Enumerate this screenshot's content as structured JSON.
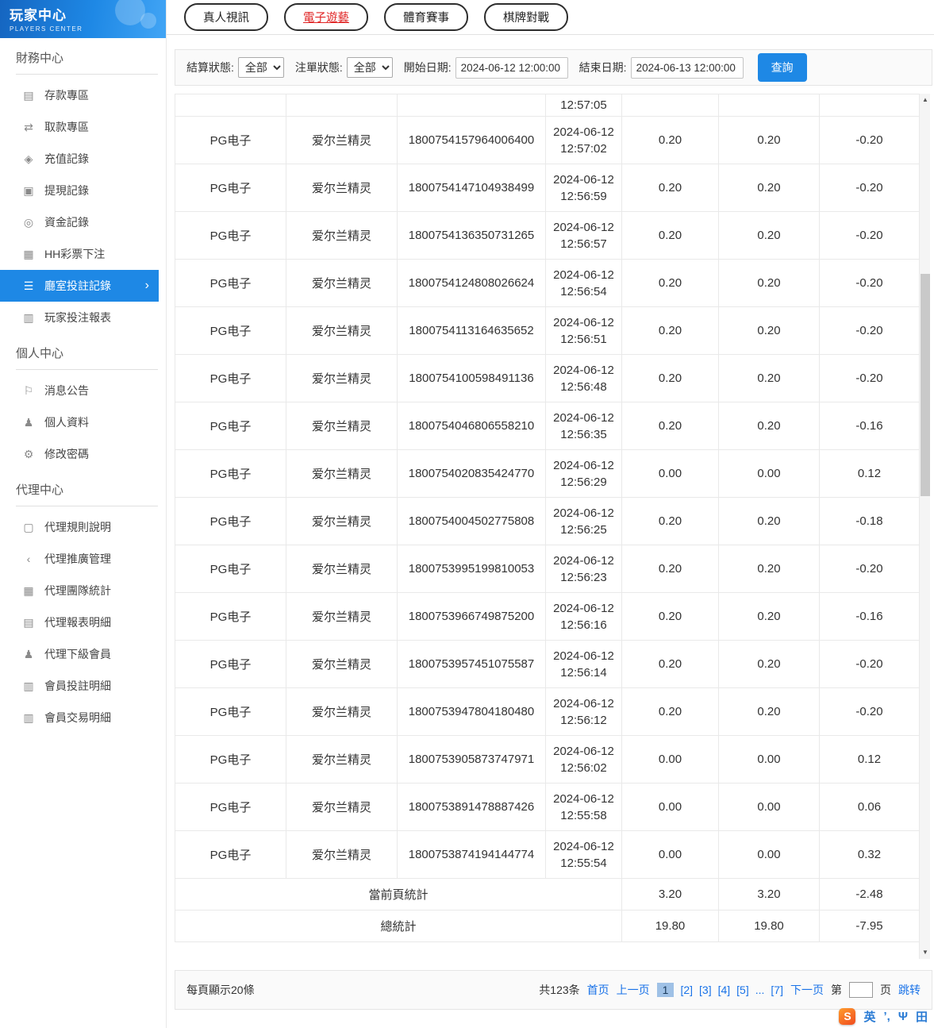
{
  "sidebar": {
    "title": "玩家中心",
    "subtitle": "PLAYERS CENTER",
    "finance": {
      "heading": "財務中心",
      "items": [
        {
          "label": "存款專區",
          "icon": "deposit-icon"
        },
        {
          "label": "取款專區",
          "icon": "withdraw-icon"
        },
        {
          "label": "充值記錄",
          "icon": "recharge-icon"
        },
        {
          "label": "提現記錄",
          "icon": "cashout-icon"
        },
        {
          "label": "資金記錄",
          "icon": "funds-icon"
        },
        {
          "label": "HH彩票下注",
          "icon": "lottery-icon"
        },
        {
          "label": "廳室投註記錄",
          "icon": "room-bet-record-icon",
          "active": true
        },
        {
          "label": "玩家投注報表",
          "icon": "player-report-icon"
        }
      ]
    },
    "personal": {
      "heading": "個人中心",
      "items": [
        {
          "label": "消息公告",
          "icon": "announcement-icon"
        },
        {
          "label": "個人資料",
          "icon": "profile-icon"
        },
        {
          "label": "修改密碼",
          "icon": "password-icon"
        }
      ]
    },
    "agent": {
      "heading": "代理中心",
      "items": [
        {
          "label": "代理規則說明",
          "icon": "agent-rules-icon"
        },
        {
          "label": "代理推廣管理",
          "icon": "agent-promo-icon"
        },
        {
          "label": "代理團隊統計",
          "icon": "agent-team-icon"
        },
        {
          "label": "代理報表明細",
          "icon": "agent-report-icon"
        },
        {
          "label": "代理下級會員",
          "icon": "agent-members-icon"
        },
        {
          "label": "會員投註明細",
          "icon": "member-bet-detail-icon"
        },
        {
          "label": "會員交易明細",
          "icon": "member-trans-detail-icon"
        }
      ]
    }
  },
  "tabs": [
    {
      "label": "真人視訊"
    },
    {
      "label": "電子遊藝",
      "active": true
    },
    {
      "label": "體育賽事"
    },
    {
      "label": "棋牌對戰"
    }
  ],
  "filters": {
    "settle_status_label": "結算狀態:",
    "settle_status_value": "全部",
    "order_status_label": "注單狀態:",
    "order_status_value": "全部",
    "start_date_label": "開始日期:",
    "start_date_value": "2024-06-12 12:00:00",
    "end_date_label": "結束日期:",
    "end_date_value": "2024-06-13 12:00:00",
    "search_label": "查詢"
  },
  "table": {
    "partial_row": {
      "time": "12:57:05"
    },
    "rows": [
      {
        "platform": "PG电子",
        "game": "爱尔兰精灵",
        "order": "1800754157964006400",
        "date": "2024-06-12",
        "time": "12:57:02",
        "bet": "0.20",
        "valid": "0.20",
        "winloss": "-0.20"
      },
      {
        "platform": "PG电子",
        "game": "爱尔兰精灵",
        "order": "1800754147104938499",
        "date": "2024-06-12",
        "time": "12:56:59",
        "bet": "0.20",
        "valid": "0.20",
        "winloss": "-0.20"
      },
      {
        "platform": "PG电子",
        "game": "爱尔兰精灵",
        "order": "1800754136350731265",
        "date": "2024-06-12",
        "time": "12:56:57",
        "bet": "0.20",
        "valid": "0.20",
        "winloss": "-0.20"
      },
      {
        "platform": "PG电子",
        "game": "爱尔兰精灵",
        "order": "1800754124808026624",
        "date": "2024-06-12",
        "time": "12:56:54",
        "bet": "0.20",
        "valid": "0.20",
        "winloss": "-0.20"
      },
      {
        "platform": "PG电子",
        "game": "爱尔兰精灵",
        "order": "1800754113164635652",
        "date": "2024-06-12",
        "time": "12:56:51",
        "bet": "0.20",
        "valid": "0.20",
        "winloss": "-0.20"
      },
      {
        "platform": "PG电子",
        "game": "爱尔兰精灵",
        "order": "1800754100598491136",
        "date": "2024-06-12",
        "time": "12:56:48",
        "bet": "0.20",
        "valid": "0.20",
        "winloss": "-0.20"
      },
      {
        "platform": "PG电子",
        "game": "爱尔兰精灵",
        "order": "1800754046806558210",
        "date": "2024-06-12",
        "time": "12:56:35",
        "bet": "0.20",
        "valid": "0.20",
        "winloss": "-0.16"
      },
      {
        "platform": "PG电子",
        "game": "爱尔兰精灵",
        "order": "1800754020835424770",
        "date": "2024-06-12",
        "time": "12:56:29",
        "bet": "0.00",
        "valid": "0.00",
        "winloss": "0.12"
      },
      {
        "platform": "PG电子",
        "game": "爱尔兰精灵",
        "order": "1800754004502775808",
        "date": "2024-06-12",
        "time": "12:56:25",
        "bet": "0.20",
        "valid": "0.20",
        "winloss": "-0.18"
      },
      {
        "platform": "PG电子",
        "game": "爱尔兰精灵",
        "order": "1800753995199810053",
        "date": "2024-06-12",
        "time": "12:56:23",
        "bet": "0.20",
        "valid": "0.20",
        "winloss": "-0.20"
      },
      {
        "platform": "PG电子",
        "game": "爱尔兰精灵",
        "order": "1800753966749875200",
        "date": "2024-06-12",
        "time": "12:56:16",
        "bet": "0.20",
        "valid": "0.20",
        "winloss": "-0.16"
      },
      {
        "platform": "PG电子",
        "game": "爱尔兰精灵",
        "order": "1800753957451075587",
        "date": "2024-06-12",
        "time": "12:56:14",
        "bet": "0.20",
        "valid": "0.20",
        "winloss": "-0.20"
      },
      {
        "platform": "PG电子",
        "game": "爱尔兰精灵",
        "order": "1800753947804180480",
        "date": "2024-06-12",
        "time": "12:56:12",
        "bet": "0.20",
        "valid": "0.20",
        "winloss": "-0.20"
      },
      {
        "platform": "PG电子",
        "game": "爱尔兰精灵",
        "order": "1800753905873747971",
        "date": "2024-06-12",
        "time": "12:56:02",
        "bet": "0.00",
        "valid": "0.00",
        "winloss": "0.12"
      },
      {
        "platform": "PG电子",
        "game": "爱尔兰精灵",
        "order": "1800753891478887426",
        "date": "2024-06-12",
        "time": "12:55:58",
        "bet": "0.00",
        "valid": "0.00",
        "winloss": "0.06"
      },
      {
        "platform": "PG电子",
        "game": "爱尔兰精灵",
        "order": "1800753874194144774",
        "date": "2024-06-12",
        "time": "12:55:54",
        "bet": "0.00",
        "valid": "0.00",
        "winloss": "0.32"
      }
    ],
    "page_summary": {
      "label": "當前頁統計",
      "bet": "3.20",
      "valid": "3.20",
      "winloss": "-2.48"
    },
    "total_summary": {
      "label": "總統計",
      "bet": "19.80",
      "valid": "19.80",
      "winloss": "-7.95"
    }
  },
  "pagination": {
    "per_page_text": "每頁顯示20條",
    "total_text": "共123条",
    "first": "首页",
    "prev": "上一页",
    "pages": [
      {
        "label": "1",
        "current": true
      },
      {
        "label": "[2]"
      },
      {
        "label": "[3]"
      },
      {
        "label": "[4]"
      },
      {
        "label": "[5]"
      },
      {
        "label": "..."
      },
      {
        "label": "[7]"
      }
    ],
    "next": "下一页",
    "jump_prefix": "第",
    "jump_suffix": "页",
    "jump_action": "跳转"
  },
  "ime": {
    "logo": "S",
    "lang": "英",
    "punct": "’,",
    "mic": "Ψ",
    "board": "田"
  },
  "icon_glyphs": {
    "deposit-icon": "▤",
    "withdraw-icon": "⇄",
    "recharge-icon": "◈",
    "cashout-icon": "▣",
    "funds-icon": "◎",
    "lottery-icon": "▦",
    "room-bet-record-icon": "☰",
    "player-report-icon": "▥",
    "announcement-icon": "⚐",
    "profile-icon": "♟",
    "password-icon": "⚙",
    "agent-rules-icon": "▢",
    "agent-promo-icon": "‹",
    "agent-team-icon": "▦",
    "agent-report-icon": "▤",
    "agent-members-icon": "♟",
    "member-bet-detail-icon": "▥",
    "member-trans-detail-icon": "▥",
    "chevron-right-icon": "›",
    "arrow-up-icon": "▲",
    "arrow-down-icon": "▼"
  },
  "colors": {
    "accent_blue": "#1e88e5",
    "active_tab_red": "#e02424",
    "link_blue": "#1a73e8"
  }
}
